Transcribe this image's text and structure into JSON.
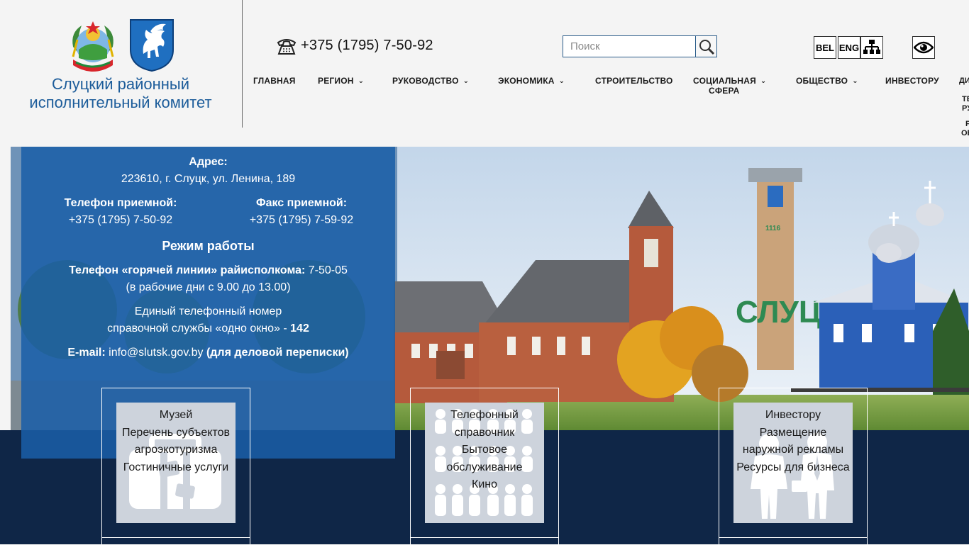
{
  "header": {
    "org_name_line1": "Слуцкий районный",
    "org_name_line2": "исполнительный комитет",
    "phone": "+375 (1795) 7-50-92",
    "search_placeholder": "Поиск",
    "lang_bel": "BEL",
    "lang_eng": "ENG",
    "emblem_icons": [
      "belarus-emblem-icon",
      "slutsk-coat-of-arms-icon"
    ],
    "control_icons": [
      "phone-icon",
      "search-icon",
      "sitemap-icon",
      "eye-icon"
    ]
  },
  "nav": {
    "items": [
      {
        "label": "ГЛАВНАЯ",
        "dropdown": false
      },
      {
        "label": "РЕГИОН",
        "dropdown": true
      },
      {
        "label": "РУКОВОДСТВО",
        "dropdown": true
      },
      {
        "label": "ЭКОНОМИКА",
        "dropdown": true
      },
      {
        "label": "СТРОИТЕЛЬСТВО",
        "dropdown": false
      },
      {
        "label": "СОЦИАЛЬНАЯ",
        "label2": "СФЕРА",
        "dropdown": true
      },
      {
        "label": "ОБЩЕСТВО",
        "dropdown": true
      },
      {
        "label": "ИНВЕСТОРУ",
        "dropdown": false
      }
    ],
    "caret": "⌄",
    "overflow": [
      {
        "label": "ДИ"
      },
      {
        "label": "ТЕ",
        "label2": "РУ"
      },
      {
        "label": "Р",
        "label2": "ОБ"
      }
    ]
  },
  "contacts": {
    "address_label": "Адрес:",
    "address": "223610, г. Слуцк, ул. Ленина, 189",
    "reception_phone_label": "Телефон приемной:",
    "reception_phone": "+375 (1795) 7-50-92",
    "reception_fax_label": "Факс приемной:",
    "reception_fax": "+375 (1795) 7-59-92",
    "work_mode_label": "Режим работы",
    "hotline_label": "Телефон «горячей линии» райисполкома:",
    "hotline_number": "7-50-05",
    "hotline_hours": "(в рабочие дни с 9.00 до 13.00)",
    "single_number_line1": "Единый телефонный номер",
    "single_number_line2": "справочной службы «одно окно» -",
    "single_number": "142",
    "email_label": "E-mail:",
    "email": "info@slutsk.gov.by",
    "email_note": "(для деловой переписки)"
  },
  "hero": {
    "sign_text": "СЛУЦК",
    "sign_year": "1116"
  },
  "tiles": [
    {
      "icon": "suitcase-icon",
      "links": [
        "Музей",
        "Перечень субъектов",
        "агроэкотуризма",
        "Гостиничные услуги"
      ]
    },
    {
      "icon": "people-grid-icon",
      "links": [
        "Телефонный",
        "справочник",
        "Бытовое",
        "обслуживание",
        "Кино"
      ]
    },
    {
      "icon": "business-people-icon",
      "links": [
        "Инвестору",
        "Размещение",
        "наружной рекламы",
        "Ресурсы для бизнеса"
      ]
    }
  ],
  "colors": {
    "brand_blue": "#1c5c9a",
    "panel_blue": "#1a5ea8",
    "dark_band": "#0f2647",
    "tile_bg": "#cdd3dc"
  }
}
